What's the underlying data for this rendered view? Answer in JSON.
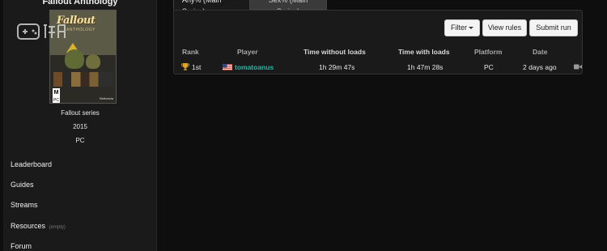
{
  "sidebar": {
    "game_title": "Fallout Anthology",
    "cover": {
      "logo": "Fallout",
      "subtitle": "ANTHOLOGY",
      "rating": "M",
      "platform_badge": "PC",
      "publisher": "Bethesda"
    },
    "series": "Fallout series",
    "year": "2015",
    "platform": "PC",
    "nav": [
      {
        "label": "Leaderboard"
      },
      {
        "label": "Guides"
      },
      {
        "label": "Streams"
      },
      {
        "label": "Resources",
        "note": "(empty)"
      },
      {
        "label": "Forum"
      }
    ],
    "watermark_icon": "gamepad-watermark-icon"
  },
  "tabs": [
    {
      "label": "Any% (Main Series)",
      "active": true
    },
    {
      "label": "Sex% (Main Series)",
      "active": false
    }
  ],
  "toolbar": {
    "filter_label": "Filter",
    "view_rules_label": "View rules",
    "submit_label": "Submit run"
  },
  "table": {
    "headers": {
      "rank": "Rank",
      "player": "Player",
      "time_without_loads": "Time without loads",
      "time_with_loads": "Time with loads",
      "platform": "Platform",
      "date": "Date"
    },
    "rows": [
      {
        "rank": "1st",
        "rank_icon": "trophy-icon",
        "flag": "us-flag-icon",
        "player": "tomatoanus",
        "time_without_loads": "1h 29m 47s",
        "time_with_loads": "1h 47m 28s",
        "platform": "PC",
        "date": "2 days ago",
        "video_icon": "video-camera-icon"
      }
    ]
  },
  "colors": {
    "background": "#0e0e0e",
    "panel": "#1a1a1a",
    "player_link": "#2ab5a3",
    "trophy": "#e0a526"
  }
}
